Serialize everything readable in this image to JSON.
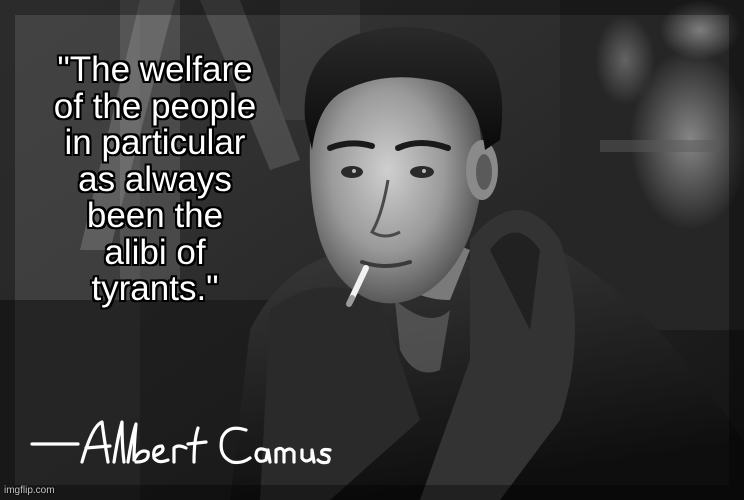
{
  "quote": {
    "lines": [
      "\"The welfare",
      "of the people",
      "in particular",
      "as always",
      "been the",
      "alibi of",
      "tyrants.\""
    ]
  },
  "signature": {
    "text": "—Albert Camus"
  },
  "watermark": {
    "text": "imgflip.com"
  },
  "colors": {
    "text": "#ffffff",
    "outline": "#000000",
    "photo_dark": "#111111",
    "photo_mid": "#6a6a6a",
    "photo_light": "#d8d8d8"
  }
}
